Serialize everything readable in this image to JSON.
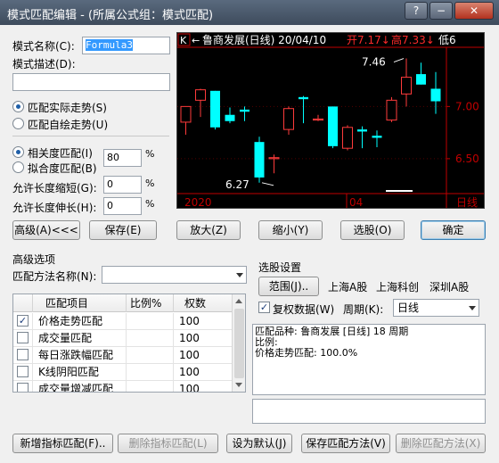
{
  "window": {
    "title": "模式匹配编辑 - (所属公式组：模式匹配)",
    "help_label": "?",
    "minimize_label": "−",
    "close_label": "✕"
  },
  "form": {
    "name_label": "模式名称(C):",
    "name_value": "Formula3",
    "desc_label": "模式描述(D):",
    "desc_value": "",
    "radio_actual": "匹配实际走势(S)",
    "radio_self": "匹配自绘走势(U)",
    "radio_corr": "相关度匹配(I)",
    "corr_value": "80",
    "radio_fit": "拟合度匹配(B)",
    "shrink_label": "允许长度缩短(G):",
    "shrink_value": "0",
    "stretch_label": "允许长度伸长(H):",
    "stretch_value": "0",
    "percent": "%"
  },
  "chart": {
    "header_k": "K",
    "header_arrow": "←",
    "header_name": "鲁商发展(日线) 20/04/10",
    "header_open": "开7.17↓",
    "header_high": "高7.33↓",
    "header_low": "低6",
    "annot_high": "7.46",
    "annot_low": "6.27",
    "xlabel_2020": "2020",
    "xlabel_04": "04",
    "period_label": "日线",
    "tick_700": "7.00",
    "tick_650": "6.50",
    "colors": {
      "up": "#ff3b3b",
      "down": "#00ffff",
      "axis": "#c00000",
      "text": "#ffffff",
      "header_red": "#ff2a2a"
    }
  },
  "chart_data": {
    "type": "candlestick",
    "ylim": [
      6.2,
      7.55
    ],
    "yticks": [
      7.0,
      6.5
    ],
    "candles": [
      {
        "o": 6.85,
        "h": 7.0,
        "l": 6.73,
        "c": 7.0
      },
      {
        "o": 7.06,
        "h": 7.17,
        "l": 6.9,
        "c": 7.16
      },
      {
        "o": 7.15,
        "h": 7.15,
        "l": 6.78,
        "c": 6.8
      },
      {
        "o": 6.92,
        "h": 6.99,
        "l": 6.84,
        "c": 6.86
      },
      {
        "o": 6.97,
        "h": 7.0,
        "l": 6.86,
        "c": 6.95
      },
      {
        "o": 6.66,
        "h": 6.71,
        "l": 6.27,
        "c": 6.32
      },
      {
        "o": 6.5,
        "h": 6.54,
        "l": 6.36,
        "c": 6.51
      },
      {
        "o": 6.78,
        "h": 7.0,
        "l": 6.73,
        "c": 6.98
      },
      {
        "o": 7.09,
        "h": 7.1,
        "l": 6.84,
        "c": 7.07
      },
      {
        "o": 6.87,
        "h": 6.92,
        "l": 6.86,
        "c": 6.88
      },
      {
        "o": 7.0,
        "h": 7.0,
        "l": 6.6,
        "c": 6.62
      },
      {
        "o": 6.6,
        "h": 6.82,
        "l": 6.58,
        "c": 6.8
      },
      {
        "o": 6.78,
        "h": 6.81,
        "l": 6.6,
        "c": 6.76
      },
      {
        "o": 6.72,
        "h": 6.77,
        "l": 6.61,
        "c": 6.7
      },
      {
        "o": 6.87,
        "h": 7.09,
        "l": 6.85,
        "c": 7.06
      },
      {
        "o": 7.12,
        "h": 7.46,
        "l": 7.0,
        "c": 7.28
      },
      {
        "o": 7.31,
        "h": 7.42,
        "l": 7.21,
        "c": 7.21
      },
      {
        "o": 7.17,
        "h": 7.33,
        "l": 6.93,
        "c": 7.05
      }
    ]
  },
  "buttons": {
    "advanced": "高级(A)<<<",
    "save": "保存(E)",
    "zoom_in": "放大(Z)",
    "zoom_out": "缩小(Y)",
    "select_stock": "选股(O)",
    "ok": "确定",
    "add_indicator": "新增指标匹配(F)..",
    "del_indicator": "删除指标匹配(L)",
    "set_default": "设为默认(J)",
    "save_method": "保存匹配方法(V)",
    "del_method": "删除匹配方法(X)"
  },
  "advanced": {
    "section_title": "高级选项",
    "method_label": "匹配方法名称(N):",
    "method_value": "",
    "columns": [
      "匹配项目",
      "比例%",
      "权数"
    ],
    "rows": [
      {
        "checked": true,
        "name": "价格走势匹配",
        "ratio": "",
        "weight": "100"
      },
      {
        "checked": false,
        "name": "成交量匹配",
        "ratio": "",
        "weight": "100"
      },
      {
        "checked": false,
        "name": "每日涨跌幅匹配",
        "ratio": "",
        "weight": "100"
      },
      {
        "checked": false,
        "name": "K线阴阳匹配",
        "ratio": "",
        "weight": "100"
      },
      {
        "checked": false,
        "name": "成交量增减匹配",
        "ratio": "",
        "weight": "100"
      }
    ]
  },
  "selection": {
    "title": "选股设置",
    "range_button": "范围(J)..",
    "markets": [
      "上海A股",
      "上海科创",
      "深圳A股"
    ],
    "restore_label": "复权数据(W)",
    "period_label": "周期(K):",
    "period_value": "日线",
    "info_lines": [
      "匹配品种: 鲁商发展 [日线] 18 周期",
      "比例:",
      "价格走势匹配: 100.0%"
    ]
  }
}
